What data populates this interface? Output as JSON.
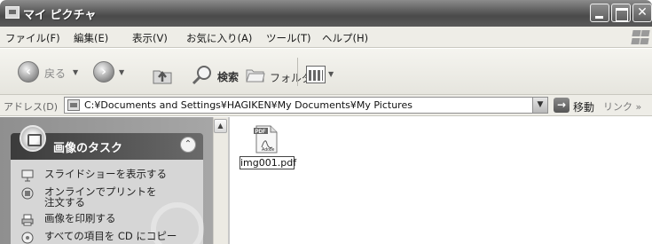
{
  "window": {
    "title": "マイ ピクチャ"
  },
  "menu": {
    "items": [
      "ファイル(F)",
      "編集(E)",
      "表示(V)",
      "お気に入り(A)",
      "ツール(T)",
      "ヘルプ(H)"
    ]
  },
  "toolbar": {
    "back_label": "戻る",
    "search_label": "検索",
    "folder_label": "フォルダ"
  },
  "address": {
    "label": "アドレス(D)",
    "value": "C:¥Documents and Settings¥HAGIKEN¥My Documents¥My Pictures",
    "go_label": "移動",
    "links_label": "リンク »"
  },
  "task_pane": {
    "title": "画像のタスク",
    "items": [
      {
        "label": "スライドショーを表示する",
        "icon": "slideshow-icon"
      },
      {
        "label": "オンラインでプリントを注文する",
        "icon": "online-print-icon"
      },
      {
        "label": "画像を印刷する",
        "icon": "print-icon"
      },
      {
        "label": "すべての項目を CD にコピー",
        "icon": "cd-copy-icon"
      }
    ]
  },
  "files": [
    {
      "name": "img001.pdf",
      "icon": "pdf-file-icon"
    }
  ]
}
